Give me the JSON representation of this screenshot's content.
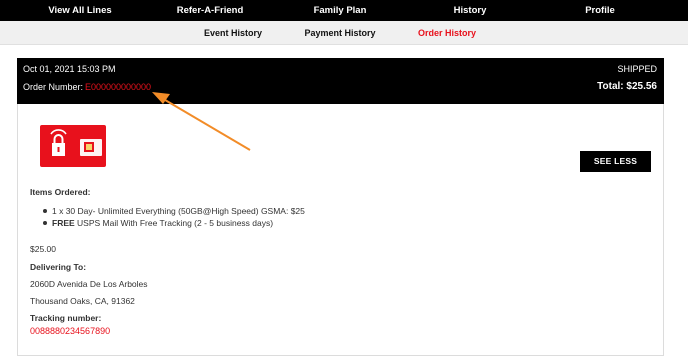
{
  "top_nav": [
    "View All Lines",
    "Refer-A-Friend",
    "Family Plan",
    "History",
    "Profile"
  ],
  "sub_nav": {
    "items": [
      "Event History",
      "Payment History",
      "Order History"
    ],
    "active": "Order History",
    "active_color": "#e8111c"
  },
  "order": {
    "date": "Oct 01, 2021 15:03 PM",
    "status": "SHIPPED",
    "number_label": "Order Number:",
    "number": "E000000000000",
    "total": "Total: $25.56"
  },
  "see_less_label": "SEE LESS",
  "items_heading": "Items Ordered:",
  "items": [
    {
      "prefix": "",
      "text": "1 x 30 Day- Unlimited Everything (50GB@High Speed) GSMA: $25"
    },
    {
      "prefix": "FREE",
      "text": " USPS Mail With Free Tracking (2 - 5 business days)"
    }
  ],
  "amount": "$25.00",
  "delivering": {
    "heading": "Delivering To:",
    "street": "2060D Avenida De Los Arboles",
    "city": "Thousand Oaks, CA, 91362"
  },
  "tracking": {
    "heading": "Tracking number:",
    "number": "0088880234567890"
  },
  "icons": {
    "sim_card": "sim-card-lock-icon",
    "arrow": "annotation-arrow-icon"
  },
  "colors": {
    "accent": "#e8111c",
    "annotation": "#f28c28"
  }
}
